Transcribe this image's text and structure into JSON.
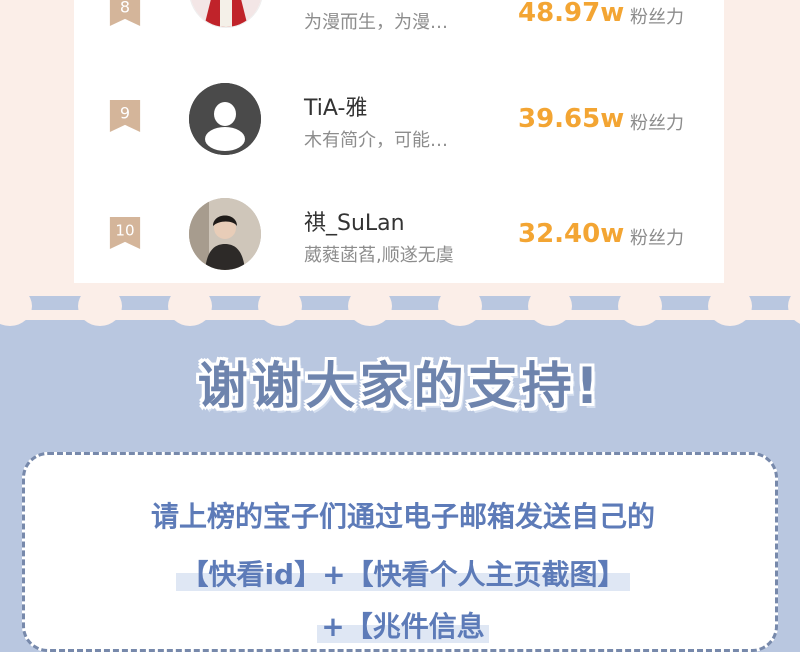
{
  "ranking": [
    {
      "rank": "8",
      "name": "",
      "bio": "为漫而生，为漫…",
      "fans": "48.97w",
      "fans_label": "粉丝力",
      "avatar": "illustrated-avatar"
    },
    {
      "rank": "9",
      "name": "TiA-雅",
      "bio": "木有简介，可能…",
      "fans": "39.65w",
      "fans_label": "粉丝力",
      "avatar": "default-avatar"
    },
    {
      "rank": "10",
      "name": "祺_SuLan",
      "bio": "葳蕤菡萏,顺遂无虞",
      "fans": "32.40w",
      "fans_label": "粉丝力",
      "avatar": "photo-avatar"
    }
  ],
  "thanks_title": "谢谢大家的支持!",
  "notice": {
    "line1": "请上榜的宝子们通过电子邮箱发送自己的",
    "line2": "【快看id】+【快看个人主页截图】",
    "line3": "+【兆件信息"
  },
  "colors": {
    "top_bg": "#fbeee8",
    "bottom_bg": "#b9c7e0",
    "rank_badge": "#d4b59a",
    "fans": "#f3a533",
    "title": "#6e84ad",
    "notice_text": "#5d7bb8"
  }
}
